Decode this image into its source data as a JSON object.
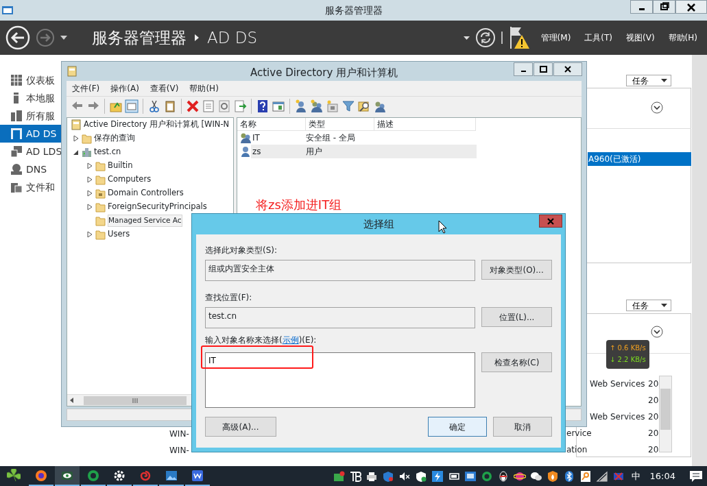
{
  "server_manager": {
    "title": "服务器管理器",
    "breadcrumb": [
      "服务器管理器",
      "AD DS"
    ],
    "menus": [
      "管理(M)",
      "工具(T)",
      "视图(V)",
      "帮助(H)"
    ],
    "sidebar": [
      {
        "label": "仪表板",
        "selected": false
      },
      {
        "label": "本地服",
        "selected": false
      },
      {
        "label": "所有服",
        "selected": false
      },
      {
        "label": "AD DS",
        "selected": true
      },
      {
        "label": "AD LDS",
        "selected": false
      },
      {
        "label": "DNS",
        "selected": false
      },
      {
        "label": "文件和",
        "selected": false
      }
    ],
    "tasks_buttons": [
      "任务",
      "任务"
    ],
    "selected_row": "A960(已激活)",
    "service_rows": [
      {
        "name": "Web Services",
        "col_2": "20"
      },
      {
        "col_2": "20"
      },
      {
        "name": "Web Services",
        "col_2": "20"
      },
      {
        "name": "ervice",
        "col_2": "20"
      },
      {
        "name": "ation",
        "col_2": "20"
      }
    ],
    "server_rows": [
      "WIN-",
      "WIN-"
    ]
  },
  "ad_window": {
    "title": "Active Directory 用户和计算机",
    "menus": [
      "文件(F)",
      "操作(A)",
      "查看(V)",
      "帮助(H)"
    ],
    "tree": [
      {
        "label": "Active Directory 用户和计算机 [WIN-N",
        "kind": "snapin",
        "selected": false,
        "children": [
          {
            "label": "保存的查询",
            "kind": "folder",
            "expanded": false,
            "selected": false
          },
          {
            "label": "test.cn",
            "kind": "domain",
            "expanded": true,
            "selected": false,
            "children": [
              {
                "label": "Builtin",
                "kind": "folder",
                "expanded": false,
                "selected": false
              },
              {
                "label": "Computers",
                "kind": "folder",
                "expanded": false,
                "selected": false
              },
              {
                "label": "Domain Controllers",
                "kind": "ou",
                "expanded": false,
                "selected": false
              },
              {
                "label": "ForeignSecurityPrincipals",
                "kind": "folder",
                "expanded": false,
                "selected": false
              },
              {
                "label": "Managed Service Ac",
                "kind": "folder",
                "selected": true
              },
              {
                "label": "Users",
                "kind": "folder",
                "expanded": false,
                "selected": false
              }
            ]
          }
        ]
      }
    ],
    "columns": [
      "名称",
      "类型",
      "描述"
    ],
    "rows": [
      {
        "name": "IT",
        "type": "安全组 - 全局",
        "kind": "group",
        "selected": false
      },
      {
        "name": "zs",
        "type": "用户",
        "kind": "user",
        "selected": true
      }
    ]
  },
  "annotation": "将zs添加进IT组",
  "dialog": {
    "title": "选择组",
    "object_type": {
      "label": "选择此对象类型(S):",
      "value": "组或内置安全主体",
      "button": "对象类型(O)..."
    },
    "location": {
      "label": "查找位置(F):",
      "value": "test.cn",
      "button": "位置(L)..."
    },
    "names": {
      "label": "输入对象名称来选择(",
      "link": "示例",
      "label_end": ")(E):",
      "value": "IT",
      "button": "检查名称(C)"
    },
    "buttons": [
      {
        "label": "高级(A)...",
        "default": false
      },
      {
        "label": "确定",
        "default": true
      },
      {
        "label": "取消",
        "default": false
      }
    ]
  },
  "net_speed": {
    "up": "↑ 0.6 KB/s",
    "down": "↓ 2.2 KB/s"
  },
  "taskbar": {
    "ime": "中",
    "time": "16:04"
  }
}
